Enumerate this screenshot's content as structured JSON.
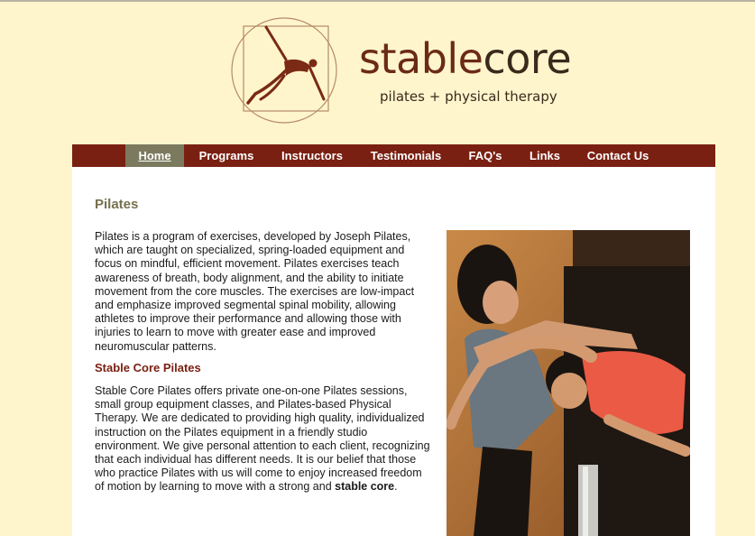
{
  "header": {
    "logo_word_light": "stable",
    "logo_word_bold": "core",
    "tagline": "pilates + physical therapy"
  },
  "nav": {
    "items": [
      {
        "label": "Home",
        "active": true
      },
      {
        "label": "Programs"
      },
      {
        "label": "Instructors"
      },
      {
        "label": "Testimonials"
      },
      {
        "label": "FAQ's"
      },
      {
        "label": "Links"
      },
      {
        "label": "Contact Us"
      }
    ]
  },
  "main": {
    "title": "Pilates",
    "intro": "Pilates is a program of exercises, developed by Joseph Pilates, which are taught on specialized, spring-loaded equipment and focus on mindful, efficient movement. Pilates exercises teach awareness of breath, body alignment, and the ability to initiate movement from the core muscles. The exercises are low-impact and emphasize improved segmental spinal mobility, allowing athletes to improve their performance and allowing those with injuries to learn to move with greater ease and improved neuromuscular patterns.",
    "subtitle": "Stable Core Pilates",
    "body_start": "Stable Core Pilates offers private one-on-one Pilates sessions, small group equipment classes, and Pilates-based Physical Therapy. We are dedicated to providing high quality, individualized instruction on the Pilates equipment in a friendly studio environment. We give personal attention to each client, recognizing that each individual has different needs. It is our belief that those who practice Pilates with us will come to enjoy increased freedom of motion by learning to move with a strong and ",
    "body_bold": "stable core",
    "body_end": "."
  },
  "colors": {
    "page_bg": "#fff5cc",
    "nav_bg": "#7a2012",
    "nav_active": "#7b7a5f",
    "title": "#76704f",
    "subtitle": "#7a2012"
  }
}
